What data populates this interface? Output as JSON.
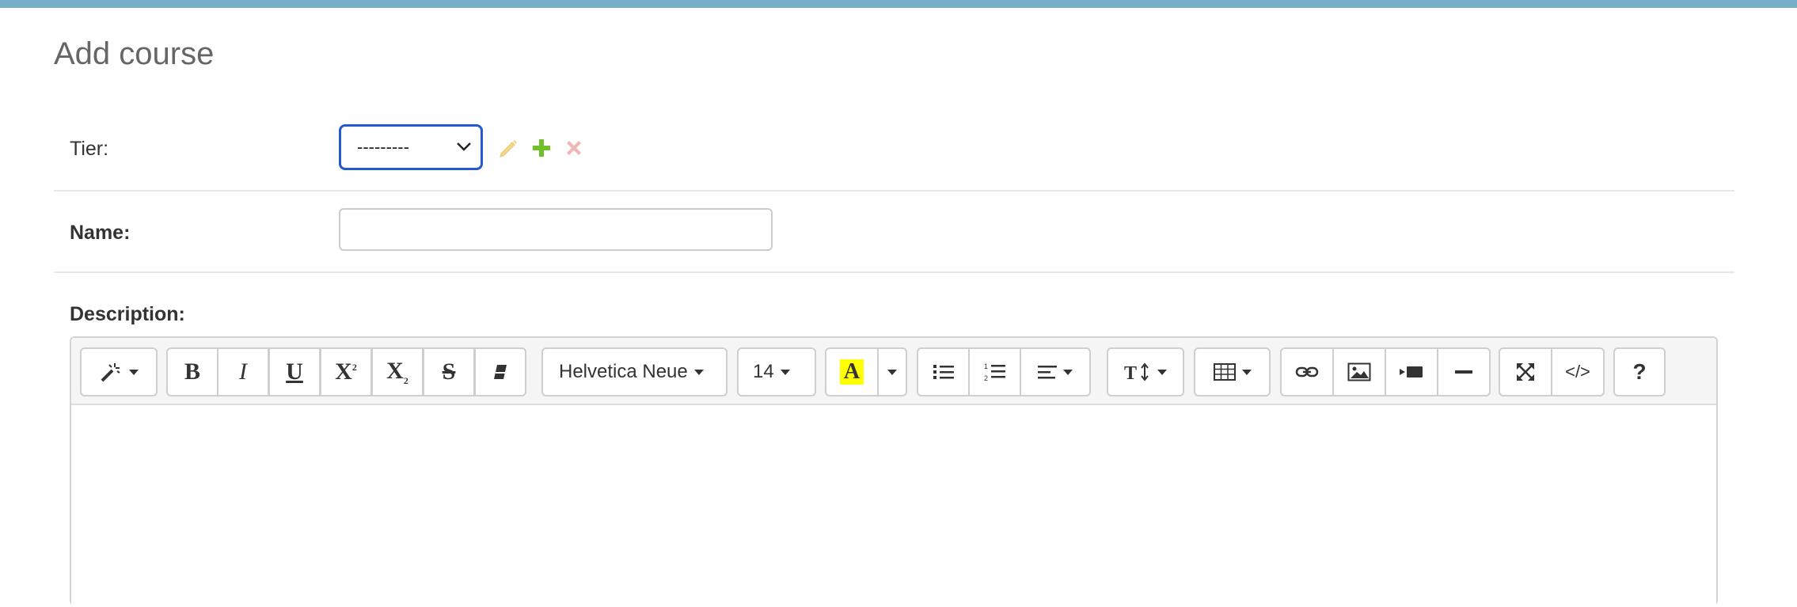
{
  "page": {
    "title": "Add course"
  },
  "tier": {
    "label": "Tier:",
    "selected": "---------",
    "icons": [
      "edit-pencil-icon",
      "add-plus-icon",
      "delete-x-icon"
    ]
  },
  "name": {
    "label": "Name:",
    "value": ""
  },
  "description": {
    "label": "Description:",
    "toolbar": {
      "font_family": "Helvetica Neue",
      "font_size": "14",
      "code_view": "</>",
      "help": "?"
    }
  },
  "colors": {
    "top_bar": "#79aec8",
    "select_focus_border": "#2459d1",
    "edit_icon": "#f3d690",
    "add_icon": "#70bf2b",
    "delete_icon": "#efb8b8",
    "highlight_yellow": "#ffff00"
  }
}
